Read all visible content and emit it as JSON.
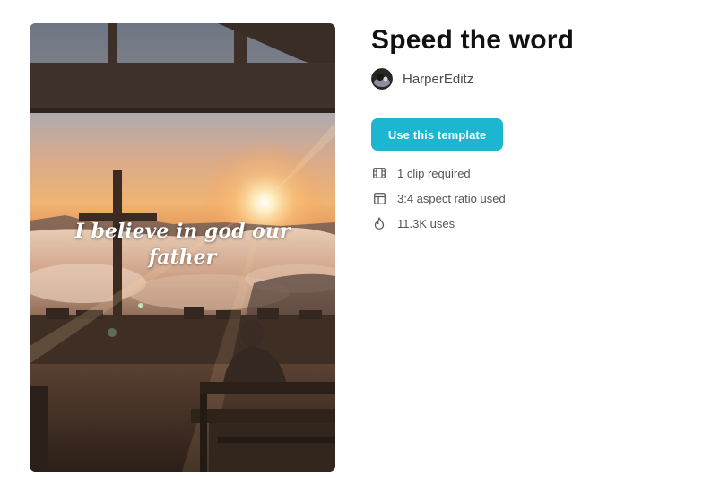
{
  "template": {
    "title": "Speed the word",
    "author": {
      "name": "HarperEditz"
    },
    "preview": {
      "caption": "I believe in god our father"
    },
    "cta_label": "Use this template",
    "meta": [
      {
        "icon": "film-clip-icon",
        "text": "1 clip required"
      },
      {
        "icon": "layout-icon",
        "text": "3:4 aspect ratio used"
      },
      {
        "icon": "flame-icon",
        "text": "11.3K uses"
      }
    ]
  },
  "colors": {
    "accent": "#1cb6d1",
    "title": "#111111",
    "muted": "#555555",
    "background": "#ffffff"
  }
}
